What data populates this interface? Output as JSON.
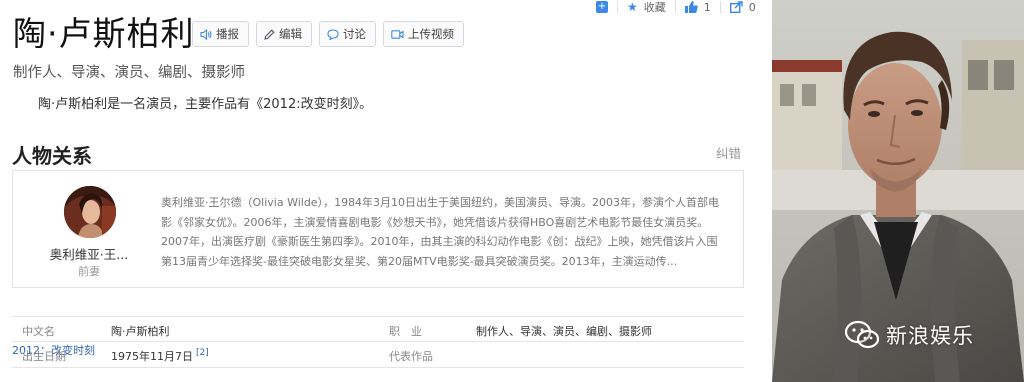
{
  "top_actions": {
    "add_icon": "plus-square-icon",
    "favorite_label": "收藏",
    "like_count": "1",
    "share_count": "0"
  },
  "header": {
    "title": "陶·卢斯柏利",
    "buttons": [
      {
        "label": "播报",
        "icon": "speaker-icon"
      },
      {
        "label": "编辑",
        "icon": "pencil-icon"
      },
      {
        "label": "讨论",
        "icon": "chat-bubble-icon"
      },
      {
        "label": "上传视频",
        "icon": "video-icon"
      }
    ],
    "subtitle": "制作人、导演、演员、编剧、摄影师",
    "summary": "陶·卢斯柏利是一名演员，主要作品有《2012:改变时刻》。"
  },
  "relations": {
    "section_title": "人物关系",
    "correction_label": "纠错",
    "person": {
      "name": "奥利维亚·王...",
      "relation": "前妻",
      "bio": "奥利维亚·王尔德（Olivia Wilde），1984年3月10日出生于美国纽约，美国演员、导演。2003年，参演个人首部电影《邻家女优》。2006年，主演爱情喜剧电影《妙想天书》，她凭借该片获得HBO喜剧艺术电影节最佳女演员奖。2007年，出演医疗剧《豪斯医生第四季》。2010年，由其主演的科幻动作电影《创：战纪》上映，她凭借该片入围第13届青少年选择奖-最佳突破电影女星奖、第20届MTV电影奖-最具突破演员奖。2013年，主演运动传..."
    }
  },
  "basic_info": {
    "rows": [
      {
        "k1": "中文名",
        "v1": "陶·卢斯柏利",
        "k2": "职　业",
        "v2": "制作人、导演、演员、编剧、摄影师"
      },
      {
        "k1": "出生日期",
        "v1": "1975年11月7日",
        "cite": "[2]",
        "k2": "代表作品",
        "v2": "2012：改变时刻"
      }
    ]
  },
  "photo": {
    "watermark_text": "新浪娱乐",
    "watermark_icon": "wechat-icon"
  },
  "colors": {
    "accent": "#3b8ae5",
    "link": "#3366bb",
    "muted": "#999999"
  }
}
